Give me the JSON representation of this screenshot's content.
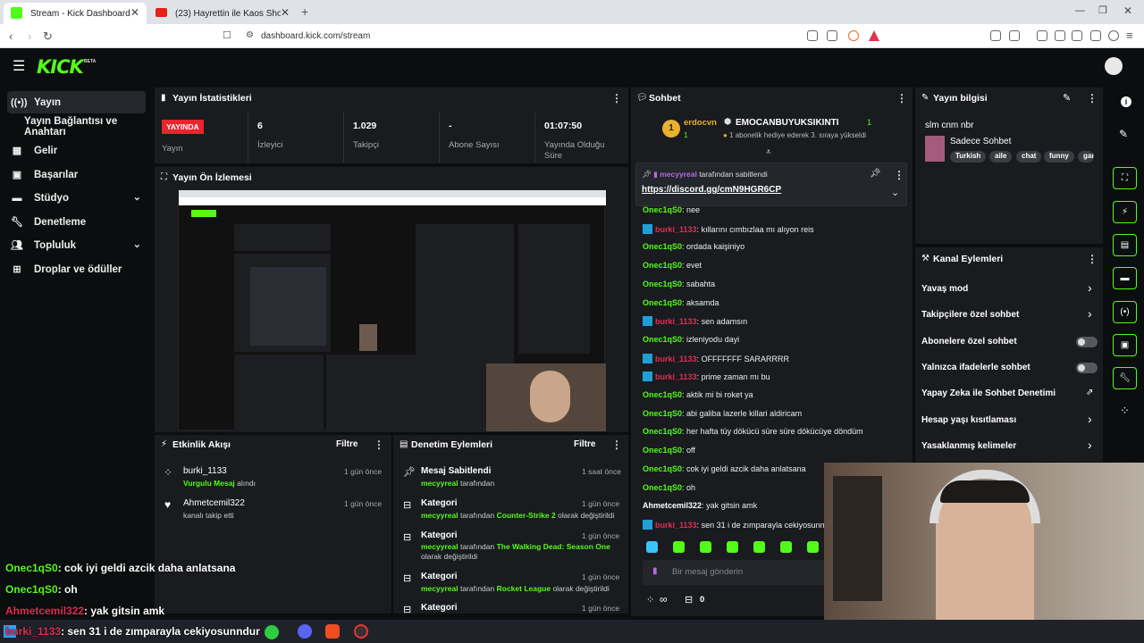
{
  "browser": {
    "tab1_title": "Stream - Kick Dashboard",
    "tab2_title": "(23) Hayrettin ile Kaos Show - 2.Sez",
    "url": "dashboard.kick.com/stream"
  },
  "header": {
    "logo": "KICK",
    "beta": "BETA"
  },
  "sidebar": {
    "items": [
      {
        "label": "Yayın",
        "icon": "broadcast-icon"
      },
      {
        "label": "Yayın Bağlantısı ve Anahtarı",
        "icon": ""
      },
      {
        "label": "Gelir",
        "icon": "revenue-icon"
      },
      {
        "label": "Başarılar",
        "icon": "achievements-icon"
      },
      {
        "label": "Stüdyo",
        "icon": "studio-icon"
      },
      {
        "label": "Denetleme",
        "icon": "wrench-icon"
      },
      {
        "label": "Topluluk",
        "icon": "community-icon"
      },
      {
        "label": "Droplar ve ödüller",
        "icon": "gift-icon"
      }
    ]
  },
  "stats": {
    "title": "Yayın İstatistikleri",
    "live_badge": "YAYINDA",
    "live_label": "Yayın",
    "viewers_value": "6",
    "viewers_label": "İzleyici",
    "followers_value": "1.029",
    "followers_label": "Takipçi",
    "subs_value": "-",
    "subs_label": "Abone Sayısı",
    "uptime_value": "01:07:50",
    "uptime_label": "Yayında Olduğu Süre"
  },
  "preview": {
    "title": "Yayın Ön İzlemesi"
  },
  "activity": {
    "title": "Etkinlik Akışı",
    "filter": "Filtre",
    "items": [
      {
        "user": "burki_1133",
        "detail_highlight": "Vurgulu Mesaj",
        "detail": " alındı",
        "time": "1 gün önce"
      },
      {
        "user": "Ahmetcemil322",
        "detail_highlight": "",
        "detail": "kanalı takip etti",
        "time": "1 gün önce"
      }
    ]
  },
  "modlog": {
    "title": "Denetim Eylemleri",
    "filter": "Filtre",
    "items": [
      {
        "title": "Mesaj Sabitlendi",
        "user": "mecyyreal",
        "pre": " tarafından",
        "highlight": "",
        "post": "",
        "line2": "",
        "time": "1 saat önce"
      },
      {
        "title": "Kategori",
        "user": "mecyyreal",
        "pre": " tarafından ",
        "highlight": "Counter-Strike 2",
        "post": " olarak değiştirildi",
        "line2": "",
        "time": "1 gün önce"
      },
      {
        "title": "Kategori",
        "user": "mecyyreal",
        "pre": " tarafından ",
        "highlight": "The Walking Dead: Season One",
        "post": "",
        "line2": "olarak değiştirildi",
        "time": "1 gün önce"
      },
      {
        "title": "Kategori",
        "user": "mecyyreal",
        "pre": " tarafından ",
        "highlight": "Rocket League",
        "post": " olarak değiştirildi",
        "line2": "",
        "time": "1 gün önce"
      },
      {
        "title": "Kategori",
        "user": "",
        "pre": "",
        "highlight": "",
        "post": "",
        "line2": "",
        "time": "1 gün önce"
      }
    ]
  },
  "chat": {
    "title": "Sohbet",
    "top_gifter": "erdocvn",
    "top_gifter_count": "1",
    "gift_user": "EMOCANBUYUKSIKINTI",
    "gift_count": "1",
    "gift_text": "1 abonelik hediye ederek 3. sıraya yükseldi",
    "pinned_by": "mecyyreal",
    "pinned_suffix": "tarafından sabitlendi",
    "pinned_link": "https://discord.gg/cmN9HGR6CP",
    "messages": [
      {
        "user": "Onec1qS0",
        "color": "green",
        "badge": false,
        "text": "nee"
      },
      {
        "user": "burki_1133",
        "color": "red",
        "badge": true,
        "text": "kıllarını cımbızlaa mı alıyon reis"
      },
      {
        "user": "Onec1qS0",
        "color": "green",
        "badge": false,
        "text": "ordada kaişiniyo"
      },
      {
        "user": "Onec1qS0",
        "color": "green",
        "badge": false,
        "text": "evet"
      },
      {
        "user": "Onec1qS0",
        "color": "green",
        "badge": false,
        "text": "sabahta"
      },
      {
        "user": "Onec1qS0",
        "color": "green",
        "badge": false,
        "text": "aksamda"
      },
      {
        "user": "burki_1133",
        "color": "red",
        "badge": true,
        "text": "sen adamsın"
      },
      {
        "user": "Onec1qS0",
        "color": "green",
        "badge": false,
        "text": "izleniyodu dayi"
      },
      {
        "user": "burki_1133",
        "color": "red",
        "badge": true,
        "text": "OFFFFFFF SARARRRR"
      },
      {
        "user": "burki_1133",
        "color": "red",
        "badge": true,
        "text": "prime zaman mı bu"
      },
      {
        "user": "Onec1qS0",
        "color": "green",
        "badge": false,
        "text": "aktik mi bi roket ya"
      },
      {
        "user": "Onec1qS0",
        "color": "green",
        "badge": false,
        "text": "abi galiba lazerle killari aldiricam"
      },
      {
        "user": "Onec1qS0",
        "color": "green",
        "badge": false,
        "text": "her hafta tüy dökücü süre süre dökücüye döndüm"
      },
      {
        "user": "Onec1qS0",
        "color": "green",
        "badge": false,
        "text": "off"
      },
      {
        "user": "Onec1qS0",
        "color": "green",
        "badge": false,
        "text": "cok iyi geldi azcik daha anlatsana"
      },
      {
        "user": "Onec1qS0",
        "color": "green",
        "badge": false,
        "text": "oh"
      },
      {
        "user": "Ahmetcemil322",
        "color": "white",
        "badge": false,
        "text": "yak gitsin amk"
      },
      {
        "user": "burki_1133",
        "color": "red",
        "badge": true,
        "text": "sen 31 i de zımparayla cekiyosunn"
      }
    ],
    "input_placeholder": "Bir mesaj gönderin",
    "points_value": "∞",
    "gift_value": "0"
  },
  "stream_info": {
    "title": "Yayın bilgisi",
    "stream_title": "slm cnm nbr",
    "category": "Sadece Sohbet",
    "tags": [
      "Turkish",
      "aile",
      "chat",
      "funny",
      "gam"
    ]
  },
  "channel_actions": {
    "title": "Kanal Eylemleri",
    "items": [
      {
        "label": "Yavaş mod",
        "control": "chevron"
      },
      {
        "label": "Takipçilere özel sohbet",
        "control": "chevron"
      },
      {
        "label": "Abonelere özel sohbet",
        "control": "toggle"
      },
      {
        "label": "Yalnızca ifadelerle sohbet",
        "control": "toggle"
      },
      {
        "label": "Yapay Zeka ile Sohbet Denetimi",
        "control": "external"
      },
      {
        "label": "Hesap yaşı kısıtlaması",
        "control": "chevron"
      },
      {
        "label": "Yasaklanmış kelimeler",
        "control": "chevron"
      }
    ]
  },
  "overlay_chat": [
    {
      "user": "Onec1qS0",
      "text": ": cok iyi geldi azcik daha anlatsana",
      "color": "#53fc18"
    },
    {
      "user": "Onec1qS0",
      "text": ": oh",
      "color": "#53fc18"
    },
    {
      "user": "Ahmetcemil322",
      "text": ": yak gitsin amk",
      "color": "#ffffff"
    },
    {
      "user": "burki_1133",
      "text": ": sen 31 i de zımparayla cekiyosunndur",
      "color": "#e02d53"
    }
  ],
  "colors": {
    "accent": "#53fc18",
    "live": "#e8252d",
    "panel": "#191b1f",
    "bg": "#0b0e0f"
  }
}
